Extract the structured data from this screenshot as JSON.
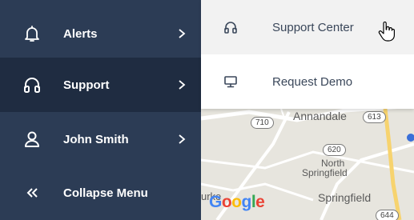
{
  "sidebar": {
    "items": [
      {
        "label": "Alerts",
        "icon": "bell-icon",
        "has_submenu": true
      },
      {
        "label": "Support",
        "icon": "headphones-icon",
        "has_submenu": true,
        "active": true
      },
      {
        "label": "John Smith",
        "icon": "user-icon",
        "has_submenu": true
      },
      {
        "label": "Collapse Menu",
        "icon": "double-chevron-left-icon",
        "has_submenu": false
      }
    ]
  },
  "submenu": {
    "items": [
      {
        "label": "Support Center",
        "icon": "headphones-icon",
        "hovered": true
      },
      {
        "label": "Request Demo",
        "icon": "monitor-icon"
      }
    ]
  },
  "map": {
    "places": [
      "Annandale",
      "North",
      "Springfield",
      "Springfield",
      "urke"
    ],
    "route_shields": [
      "710",
      "613",
      "620",
      "644"
    ],
    "brand": "Google"
  },
  "colors": {
    "sidebar_bg": "#2c3c55",
    "sidebar_active_bg": "#1f2c41",
    "submenu_bg": "#ffffff",
    "submenu_hover_bg": "#f2f2f2",
    "submenu_text": "#3a475a"
  }
}
